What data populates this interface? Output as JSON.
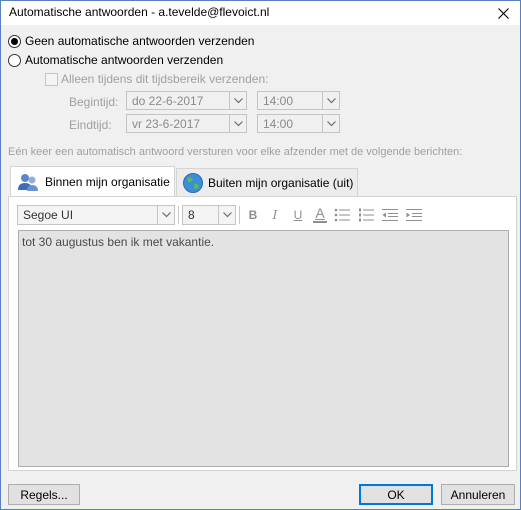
{
  "window": {
    "title": "Automatische antwoorden - a.tevelde@flevoict.nl"
  },
  "options": {
    "no_auto_reply": "Geen automatische antwoorden verzenden",
    "send_auto_reply": "Automatische antwoorden verzenden",
    "only_time_range": "Alleen tijdens dit tijdsbereik verzenden:",
    "selected": "no_auto_reply"
  },
  "schedule": {
    "start_label": "Begintijd:",
    "start_date": "do 22-6-2017",
    "start_time": "14:00",
    "end_label": "Eindtijd:",
    "end_date": "vr 23-6-2017",
    "end_time": "14:00"
  },
  "info_text": "Eén keer een automatisch antwoord versturen voor elke afzender met de volgende berichten:",
  "tabs": [
    {
      "label": "Binnen mijn organisatie",
      "active": true
    },
    {
      "label": "Buiten mijn organisatie (uit)",
      "active": false
    }
  ],
  "format_toolbar": {
    "font": "Segoe UI",
    "size": "8",
    "bold": "B",
    "italic": "I",
    "underline": "U",
    "font_color": "A"
  },
  "message": "tot 30 augustus ben ik met vakantie.",
  "buttons": {
    "rules": "Regels...",
    "ok": "OK",
    "cancel": "Annuleren"
  },
  "colors": {
    "accent": "#0078d7",
    "window_bg": "#f0f0f0",
    "editor_bg": "#e3e3e3"
  }
}
